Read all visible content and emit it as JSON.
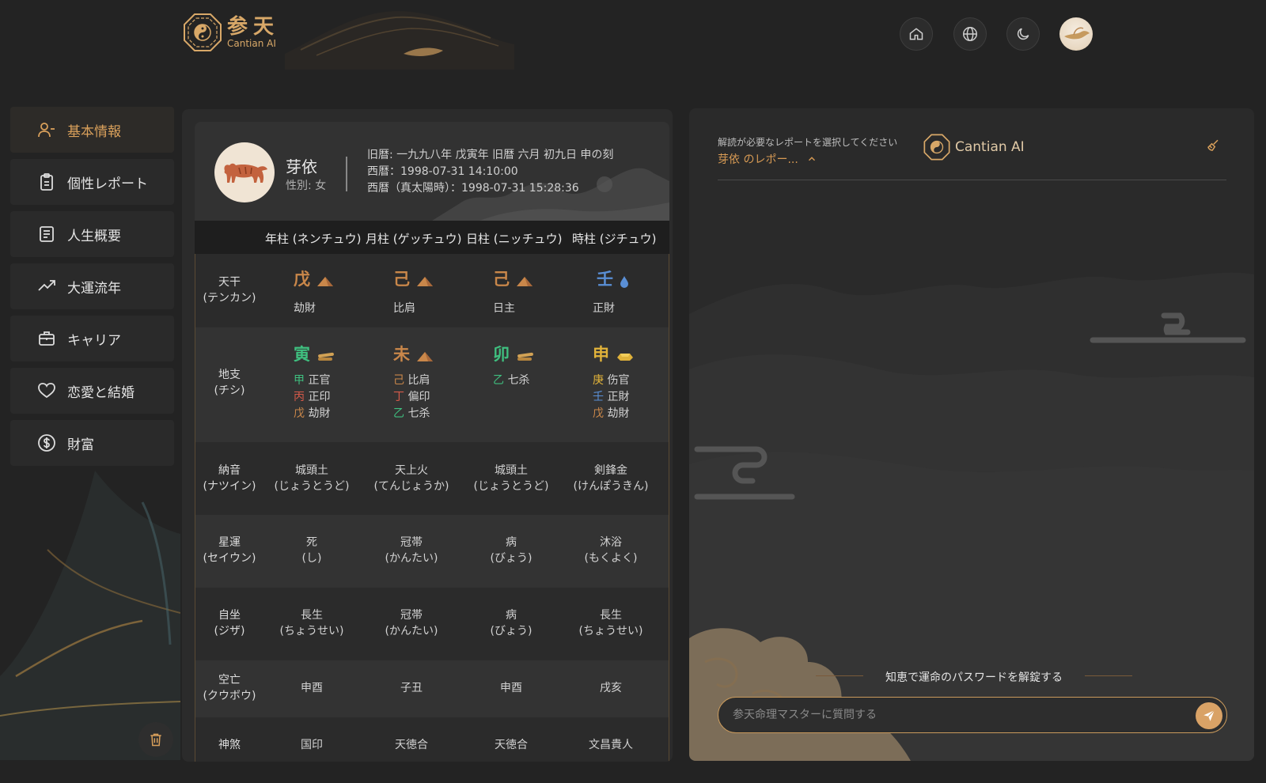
{
  "header": {
    "logo_cn": "参天",
    "logo_en": "Cantian AI",
    "buttons": [
      {
        "name": "home-button",
        "icon": "home-icon"
      },
      {
        "name": "language-button",
        "icon": "globe-icon"
      },
      {
        "name": "theme-button",
        "icon": "moon-icon"
      }
    ]
  },
  "sidebar": {
    "items": [
      {
        "label": "基本情報",
        "icon": "user-icon",
        "active": true
      },
      {
        "label": "個性レポート",
        "icon": "clipboard-icon"
      },
      {
        "label": "人生概要",
        "icon": "document-icon"
      },
      {
        "label": "大運流年",
        "icon": "trending-up-icon"
      },
      {
        "label": "キャリア",
        "icon": "briefcase-icon"
      },
      {
        "label": "恋愛と結婚",
        "icon": "heart-icon"
      },
      {
        "label": "財富",
        "icon": "dollar-icon"
      }
    ]
  },
  "profile": {
    "name": "芽依",
    "gender": "性別: 女",
    "lunar": "旧暦: 一九九八年 戊寅年 旧暦 六月 初九日 申の刻",
    "solar": "西暦：1998-07-31 14:10:00",
    "true_solar": "西暦（真太陽時）：1998-07-31 15:28:36"
  },
  "pillars": {
    "headers": [
      "年柱 (ネンチュウ)",
      "月柱 (ゲッチュウ)",
      "日柱 (ニッチュウ)",
      "時柱 (ジチュウ)"
    ],
    "heavenly_stem": {
      "label1": "天干",
      "label2": "(テンカン)",
      "chars": [
        "戊",
        "己",
        "己",
        "壬"
      ],
      "gods": [
        "劫財",
        "比肩",
        "日主",
        "正財"
      ]
    },
    "earthly_branch": {
      "label1": "地支",
      "label2": "(チシ)",
      "chars": [
        "寅",
        "未",
        "卯",
        "申"
      ],
      "hidden": [
        [
          [
            "甲",
            "正官"
          ],
          [
            "丙",
            "正印"
          ],
          [
            "戊",
            "劫財"
          ]
        ],
        [
          [
            "己",
            "比肩"
          ],
          [
            "丁",
            "偏印"
          ],
          [
            "乙",
            "七杀"
          ]
        ],
        [
          [
            "乙",
            "七杀"
          ]
        ],
        [
          [
            "庚",
            "伤官"
          ],
          [
            "壬",
            "正財"
          ],
          [
            "戊",
            "劫財"
          ]
        ]
      ]
    },
    "nayin": {
      "label1": "納音",
      "label2": "(ナツイン)",
      "values": [
        [
          "城頭土",
          "(じょうとうど)"
        ],
        [
          "天上火",
          "(てんじょうか)"
        ],
        [
          "城頭土",
          "(じょうとうど)"
        ],
        [
          "剣鋒金",
          "(けんぽうきん)"
        ]
      ]
    },
    "star_fortune": {
      "label1": "星運",
      "label2": "(セイウン)",
      "values": [
        [
          "死",
          "(し)"
        ],
        [
          "冠帯",
          "(かんたい)"
        ],
        [
          "病",
          "(びょう)"
        ],
        [
          "沐浴",
          "(もくよく)"
        ]
      ]
    },
    "self_seat": {
      "label1": "自坐",
      "label2": "(ジザ)",
      "values": [
        [
          "長生",
          "(ちょうせい)"
        ],
        [
          "冠帯",
          "(かんたい)"
        ],
        [
          "病",
          "(びょう)"
        ],
        [
          "長生",
          "(ちょうせい)"
        ]
      ]
    },
    "void": {
      "label1": "空亡",
      "label2": "(クウボウ)",
      "values": [
        "申酉",
        "子丑",
        "申酉",
        "戌亥"
      ]
    },
    "shensha": {
      "label1": "神煞",
      "values": [
        "国印",
        "天徳合",
        "天徳合",
        "文昌貴人"
      ]
    }
  },
  "report_panel": {
    "hint": "解読が必要なレポートを選択してください",
    "selected": "芽依 のレポー...",
    "brand": "Cantian AI",
    "slogan": "知恵で運命のパスワードを解錠する",
    "input_placeholder": "参天命理マスターに質問する"
  },
  "colors": {
    "accent": "#d9a05b",
    "earth": "#c9874a",
    "water": "#5a8fd6",
    "wood": "#3fbf7f",
    "fire": "#d65a4a",
    "metal": "#e0b23a"
  }
}
